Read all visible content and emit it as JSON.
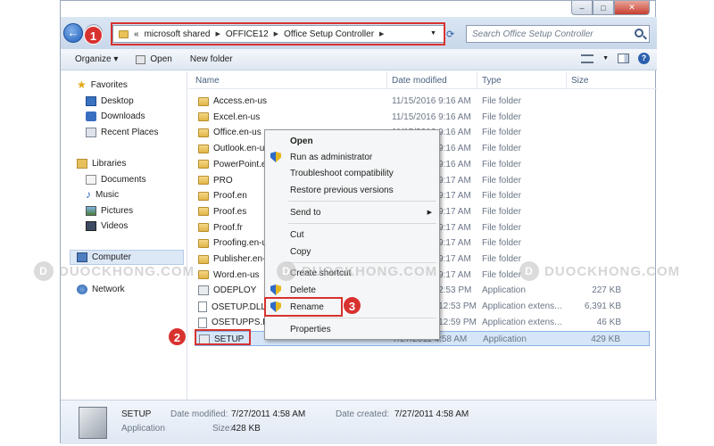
{
  "window": {
    "caption": {
      "minimize": "–",
      "maximize": "□",
      "close": "✕"
    }
  },
  "address": {
    "prefix": "«",
    "crumbs": [
      "microsoft shared",
      "OFFICE12",
      "Office Setup Controller"
    ],
    "search_placeholder": "Search Office Setup Controller"
  },
  "toolbar": {
    "organize": "Organize ▾",
    "open": "Open",
    "new_folder": "New folder"
  },
  "nav": {
    "favorites": "Favorites",
    "desktop": "Desktop",
    "downloads": "Downloads",
    "recent": "Recent Places",
    "libraries": "Libraries",
    "documents": "Documents",
    "music": "Music",
    "pictures": "Pictures",
    "videos": "Videos",
    "computer": "Computer",
    "network": "Network"
  },
  "columns": {
    "name": "Name",
    "date": "Date modified",
    "type": "Type",
    "size": "Size"
  },
  "files": [
    {
      "name": "Access.en-us",
      "date": "11/15/2016 9:16 AM",
      "type": "File folder",
      "size": "",
      "icon": "folder-icon"
    },
    {
      "name": "Excel.en-us",
      "date": "11/15/2016 9:16 AM",
      "type": "File folder",
      "size": "",
      "icon": "folder-icon"
    },
    {
      "name": "Office.en-us",
      "date": "11/15/2016 9:16 AM",
      "type": "File folder",
      "size": "",
      "icon": "folder-icon"
    },
    {
      "name": "Outlook.en-us",
      "date": "11/15/2016 9:16 AM",
      "type": "File folder",
      "size": "",
      "icon": "folder-icon"
    },
    {
      "name": "PowerPoint.en",
      "date": "11/15/2016 9:16 AM",
      "type": "File folder",
      "size": "",
      "icon": "folder-icon"
    },
    {
      "name": "PRO",
      "date": "11/15/2016 9:17 AM",
      "type": "File folder",
      "size": "",
      "icon": "folder-icon"
    },
    {
      "name": "Proof.en",
      "date": "11/15/2016 9:17 AM",
      "type": "File folder",
      "size": "",
      "icon": "folder-icon"
    },
    {
      "name": "Proof.es",
      "date": "11/15/2016 9:17 AM",
      "type": "File folder",
      "size": "",
      "icon": "folder-icon"
    },
    {
      "name": "Proof.fr",
      "date": "11/15/2016 9:17 AM",
      "type": "File folder",
      "size": "",
      "icon": "folder-icon"
    },
    {
      "name": "Proofing.en-us",
      "date": "11/15/2016 9:17 AM",
      "type": "File folder",
      "size": "",
      "icon": "folder-icon"
    },
    {
      "name": "Publisher.en-us",
      "date": "11/15/2016 9:17 AM",
      "type": "File folder",
      "size": "",
      "icon": "folder-icon"
    },
    {
      "name": "Word.en-us",
      "date": "11/15/2016 9:17 AM",
      "type": "File folder",
      "size": "",
      "icon": "folder-icon"
    },
    {
      "name": "ODEPLOY",
      "date": "11/15/2016 2:53 PM",
      "type": "Application",
      "size": "227 KB",
      "icon": "application-icon"
    },
    {
      "name": "OSETUP.DLL",
      "date": "11/15/2016 12:53 PM",
      "type": "Application extens...",
      "size": "6,391 KB",
      "icon": "dll-icon"
    },
    {
      "name": "OSETUPPS.DLL",
      "date": "11/15/2016 12:59 PM",
      "type": "Application extens...",
      "size": "46 KB",
      "icon": "dll-icon"
    },
    {
      "name": "SETUP",
      "date": "7/27/2011 4:58 AM",
      "type": "Application",
      "size": "429 KB",
      "icon": "application-icon"
    }
  ],
  "context_menu": {
    "open": "Open",
    "run_as_admin": "Run as administrator",
    "troubleshoot": "Troubleshoot compatibility",
    "restore": "Restore previous versions",
    "send_to": "Send to",
    "cut": "Cut",
    "copy": "Copy",
    "create_shortcut": "Create shortcut",
    "delete": "Delete",
    "rename": "Rename",
    "properties": "Properties"
  },
  "steps": [
    "1",
    "2",
    "3"
  ],
  "watermark": {
    "logo": "D",
    "text": "DUOCKHONG.COM"
  },
  "details": {
    "name": "SETUP",
    "type": "Application",
    "date_modified_label": "Date modified:",
    "date_modified": "7/27/2011 4:58 AM",
    "size_label": "Size:",
    "size": "428 KB",
    "date_created_label": "Date created:",
    "date_created": "7/27/2011 4:58 AM"
  },
  "colors": {
    "highlight_red": "#d8322f",
    "selection_blue": "#d6e6f8",
    "folder_yellow": "#e2b548"
  }
}
